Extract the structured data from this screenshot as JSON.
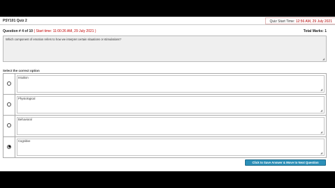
{
  "header": {
    "quiz_name": "PSY101 Quiz 2",
    "start_time_label": "Quiz Start Time: ",
    "start_time_value": "12:56 AM, 29 July 2021"
  },
  "question": {
    "number_label": "Question # 4 of 10",
    "start_time": "( Start time: 11:00:26 AM, 29 July 2021 )",
    "total_marks_label": "Total Marks: 1",
    "text": "Which component of emotion refers to how we interpret certain situations or stimulations?"
  },
  "options_label": "Select the correct option",
  "options": [
    {
      "label": "Intuition",
      "selected": false
    },
    {
      "label": "Physiological",
      "selected": false
    },
    {
      "label": "Behavioral",
      "selected": false
    },
    {
      "label": "Cognitive",
      "selected": true
    }
  ],
  "submit_label": "Click to Save Answer & Move to Next Question"
}
